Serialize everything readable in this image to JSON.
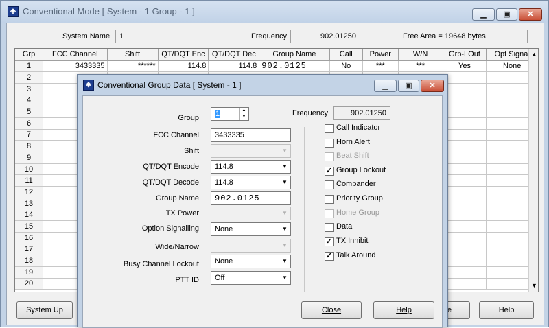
{
  "main": {
    "title": "Conventional Mode [ System - 1  Group - 1 ]",
    "system_name_label": "System Name",
    "system_name_value": "1",
    "frequency_label": "Frequency",
    "frequency_value": "902.01250",
    "free_area": "Free Area = 19648 bytes",
    "system_up_button": "System Up",
    "hidden_button_fragment": "e",
    "help_button": "Help"
  },
  "grid": {
    "columns": [
      "Grp",
      "FCC Channel",
      "Shift",
      "QT/DQT Enc",
      "QT/DQT Dec",
      "Group Name",
      "Call",
      "Power",
      "W/N",
      "Grp-LOut",
      "Opt Signal"
    ],
    "rows": [
      {
        "grp": "1",
        "fcc": "3433335",
        "shift": "******",
        "enc": "114.8",
        "dec": "114.8",
        "name": "902.0125",
        "call": "No",
        "power": "***",
        "wn": "***",
        "lout": "Yes",
        "opt": "None"
      },
      {
        "grp": "2"
      },
      {
        "grp": "3"
      },
      {
        "grp": "4"
      },
      {
        "grp": "5"
      },
      {
        "grp": "6"
      },
      {
        "grp": "7"
      },
      {
        "grp": "8"
      },
      {
        "grp": "9"
      },
      {
        "grp": "10"
      },
      {
        "grp": "11"
      },
      {
        "grp": "12"
      },
      {
        "grp": "13"
      },
      {
        "grp": "14"
      },
      {
        "grp": "15"
      },
      {
        "grp": "16"
      },
      {
        "grp": "17"
      },
      {
        "grp": "18"
      },
      {
        "grp": "19"
      },
      {
        "grp": "20"
      }
    ]
  },
  "dialog": {
    "title": "Conventional Group Data [ System - 1 ]",
    "group_label": "Group",
    "group_value": "1",
    "frequency_label": "Frequency",
    "frequency_value": "902.01250",
    "fcc_channel_label": "FCC Channel",
    "fcc_channel_value": "3433335",
    "shift_label": "Shift",
    "shift_value": "",
    "encode_label": "QT/DQT Encode",
    "encode_value": "114.8",
    "decode_label": "QT/DQT Decode",
    "decode_value": "114.8",
    "group_name_label": "Group Name",
    "group_name_value": "902.0125",
    "tx_power_label": "TX Power",
    "tx_power_value": "",
    "option_signalling_label": "Option Signalling",
    "option_signalling_value": "None",
    "wide_narrow_label": "Wide/Narrow",
    "wide_narrow_value": "",
    "busy_channel_label": "Busy Channel Lockout",
    "busy_channel_value": "None",
    "ptt_id_label": "PTT ID",
    "ptt_id_value": "Off",
    "checkboxes": [
      {
        "label": "Call Indicator",
        "checked": false,
        "enabled": true
      },
      {
        "label": "Horn Alert",
        "checked": false,
        "enabled": true
      },
      {
        "label": "Beat Shift",
        "checked": false,
        "enabled": false
      },
      {
        "label": "Group Lockout",
        "checked": true,
        "enabled": true
      },
      {
        "label": "Compander",
        "checked": false,
        "enabled": true
      },
      {
        "label": "Priority Group",
        "checked": false,
        "enabled": true
      },
      {
        "label": "Home Group",
        "checked": false,
        "enabled": false
      },
      {
        "label": "Data",
        "checked": false,
        "enabled": true
      },
      {
        "label": "TX Inhibit",
        "checked": true,
        "enabled": true
      },
      {
        "label": "Talk Around",
        "checked": true,
        "enabled": true
      }
    ],
    "close_button": "Close",
    "help_button": "Help"
  },
  "icons": {
    "app": "app-logo-icon",
    "minimize": "minimize-icon",
    "maximize": "maximize-icon",
    "close": "close-icon",
    "dropdown": "chevron-down-icon"
  },
  "colors": {
    "titlebar": "#c3d3e6",
    "close_button": "#c94f36",
    "highlight": "#3399ff"
  }
}
